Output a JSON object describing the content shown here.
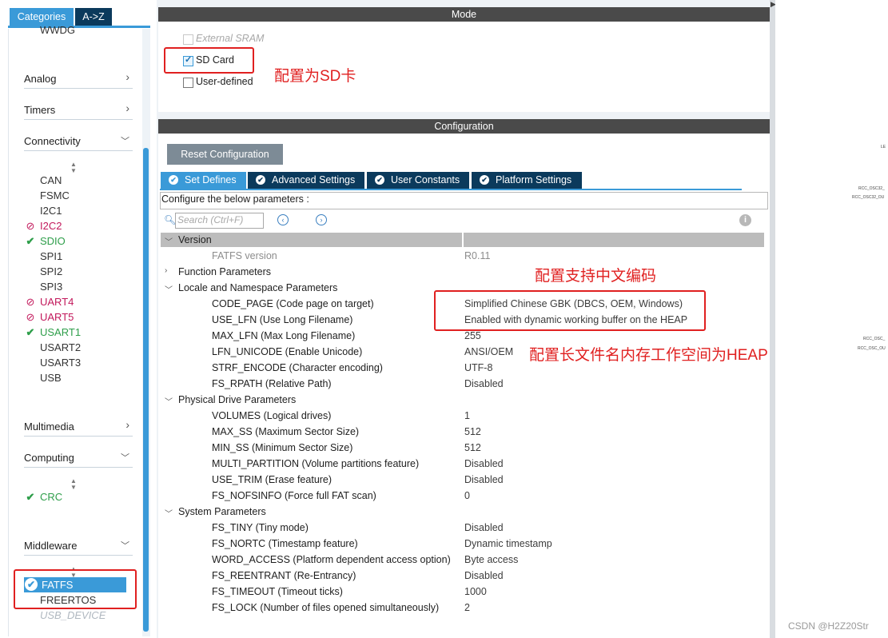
{
  "left_panel": {
    "tabs": [
      "Categories",
      "A->Z"
    ],
    "cut_top_item": "WWDG",
    "categories": {
      "analog": "Analog",
      "timers": "Timers",
      "connectivity": "Connectivity",
      "multimedia": "Multimedia",
      "computing": "Computing",
      "middleware": "Middleware"
    },
    "connectivity_items": [
      {
        "label": "CAN",
        "status": "none"
      },
      {
        "label": "FSMC",
        "status": "none"
      },
      {
        "label": "I2C1",
        "status": "none"
      },
      {
        "label": "I2C2",
        "status": "error"
      },
      {
        "label": "SDIO",
        "status": "ok"
      },
      {
        "label": "SPI1",
        "status": "none"
      },
      {
        "label": "SPI2",
        "status": "none"
      },
      {
        "label": "SPI3",
        "status": "none"
      },
      {
        "label": "UART4",
        "status": "error"
      },
      {
        "label": "UART5",
        "status": "error"
      },
      {
        "label": "USART1",
        "status": "ok"
      },
      {
        "label": "USART2",
        "status": "none"
      },
      {
        "label": "USART3",
        "status": "none"
      },
      {
        "label": "USB",
        "status": "none"
      }
    ],
    "computing_items": [
      {
        "label": "CRC",
        "status": "ok"
      }
    ],
    "middleware_items": [
      {
        "label": "FATFS",
        "status": "selected"
      },
      {
        "label": "FREERTOS",
        "status": "none"
      },
      {
        "label": "USB_DEVICE",
        "status": "disabled"
      }
    ]
  },
  "mode": {
    "header": "Mode",
    "options": [
      {
        "label": "External SRAM",
        "checked": false,
        "disabled": true
      },
      {
        "label": "SD Card",
        "checked": true,
        "disabled": false
      },
      {
        "label": "User-defined",
        "checked": false,
        "disabled": false
      }
    ]
  },
  "configuration": {
    "header": "Configuration",
    "reset_button": "Reset Configuration",
    "tabs": [
      {
        "label": "Set Defines",
        "active": true
      },
      {
        "label": "Advanced Settings",
        "active": false
      },
      {
        "label": "User Constants",
        "active": false
      },
      {
        "label": "Platform Settings",
        "active": false
      }
    ],
    "configure_label": "Configure the below parameters :",
    "search_placeholder": "Search (Ctrl+F)",
    "groups": [
      {
        "name": "Version",
        "params": [
          {
            "name": "FATFS version",
            "value": "R0.11"
          }
        ]
      },
      {
        "name": "Function Parameters",
        "params": []
      },
      {
        "name": "Locale and Namespace Parameters",
        "params": [
          {
            "name": "CODE_PAGE (Code page on target)",
            "value": "Simplified Chinese GBK (DBCS, OEM, Windows)"
          },
          {
            "name": "USE_LFN (Use Long Filename)",
            "value": "Enabled with dynamic working buffer on the HEAP"
          },
          {
            "name": "MAX_LFN (Max Long Filename)",
            "value": "255"
          },
          {
            "name": "LFN_UNICODE (Enable Unicode)",
            "value": "ANSI/OEM"
          },
          {
            "name": "STRF_ENCODE (Character encoding)",
            "value": "UTF-8"
          },
          {
            "name": "FS_RPATH (Relative Path)",
            "value": "Disabled"
          }
        ]
      },
      {
        "name": "Physical Drive Parameters",
        "params": [
          {
            "name": "VOLUMES (Logical drives)",
            "value": "1"
          },
          {
            "name": "MAX_SS (Maximum Sector Size)",
            "value": "512"
          },
          {
            "name": "MIN_SS (Minimum Sector Size)",
            "value": "512"
          },
          {
            "name": "MULTI_PARTITION (Volume partitions feature)",
            "value": "Disabled"
          },
          {
            "name": "USE_TRIM (Erase feature)",
            "value": "Disabled"
          },
          {
            "name": "FS_NOFSINFO (Force full FAT scan)",
            "value": "0"
          }
        ]
      },
      {
        "name": "System Parameters",
        "params": [
          {
            "name": "FS_TINY (Tiny mode)",
            "value": "Disabled"
          },
          {
            "name": "FS_NORTC (Timestamp feature)",
            "value": "Dynamic timestamp"
          },
          {
            "name": "WORD_ACCESS (Platform dependent access option)",
            "value": "Byte access"
          },
          {
            "name": "FS_REENTRANT (Re-Entrancy)",
            "value": "Disabled"
          },
          {
            "name": "FS_TIMEOUT (Timeout ticks)",
            "value": "1000"
          },
          {
            "name": "FS_LOCK (Number of files opened simultaneously)",
            "value": "2"
          }
        ]
      }
    ]
  },
  "annotations": {
    "sd_card": "配置为SD卡",
    "chinese": "配置支持中文编码",
    "heap": "配置长文件名内存工作空间为HEAP"
  },
  "right_strip_labels": [
    "LE",
    "RCC_OSC32_",
    "RCC_OSC32_OU",
    "RCC_OSC_",
    "RCC_OSC_OU"
  ],
  "watermark": "CSDN @H2Z20Str",
  "colors": {
    "accent": "#3a9ad8",
    "dark_tab": "#0b3a5c",
    "error": "#c2185b",
    "ok": "#2e9e4a",
    "annotation": "#e02020"
  }
}
